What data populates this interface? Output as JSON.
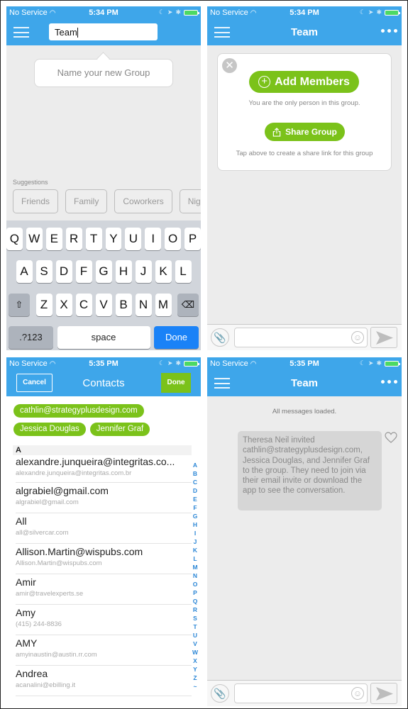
{
  "status_bar": {
    "carrier": "No Service",
    "time_screen1": "5:34 PM",
    "time_screen2": "5:34 PM",
    "time_screen3": "5:35 PM",
    "time_screen4": "5:35 PM"
  },
  "name_group_screen": {
    "title_input_value": "Team",
    "tooltip": "Name your new Group",
    "suggestions_label": "Suggestions",
    "suggestions": [
      "Friends",
      "Family",
      "Coworkers",
      "Nigh"
    ],
    "keyboard": {
      "row1": [
        "Q",
        "W",
        "E",
        "R",
        "T",
        "Y",
        "U",
        "I",
        "O",
        "P"
      ],
      "row2": [
        "A",
        "S",
        "D",
        "F",
        "G",
        "H",
        "J",
        "K",
        "L"
      ],
      "row3": [
        "Z",
        "X",
        "C",
        "V",
        "B",
        "N",
        "M"
      ],
      "symbols_key": ".?123",
      "space_key": "space",
      "done_key": "Done"
    }
  },
  "group_screen": {
    "title": "Team",
    "add_members_label": "Add Members",
    "only_person_note": "You are the only person in this group.",
    "share_group_label": "Share Group",
    "share_note": "Tap above to create a share link for this group"
  },
  "contacts_screen": {
    "title": "Contacts",
    "cancel_label": "Cancel",
    "done_label": "Done",
    "selected_tags": [
      "cathlin@strategyplusdesign.com",
      "Jessica Douglas",
      "Jennifer Graf"
    ],
    "section_header": "A",
    "contacts": [
      {
        "name": "alexandre.junqueira@integritas.co...",
        "detail": "alexandre.junqueira@integritas.com.br"
      },
      {
        "name": "algrabiel@gmail.com",
        "detail": "algrabiel@gmail.com"
      },
      {
        "name": "All",
        "detail": "all@silvercar.com"
      },
      {
        "name": "Allison.Martin@wispubs.com",
        "detail": "Allison.Martin@wispubs.com"
      },
      {
        "name": "Amir",
        "detail": "amir@travelexperts.se"
      },
      {
        "name": "Amy",
        "detail": "(415) 244-8836"
      },
      {
        "name": "AMY",
        "detail": "amyinaustin@austin.rr.com"
      },
      {
        "name": "Andrea",
        "detail": "acanalini@ebilling.it"
      }
    ],
    "index_letters": [
      "A",
      "B",
      "C",
      "D",
      "E",
      "F",
      "G",
      "H",
      "I",
      "J",
      "K",
      "L",
      "M",
      "N",
      "O",
      "P",
      "Q",
      "R",
      "S",
      "T",
      "U",
      "V",
      "W",
      "X",
      "Y",
      "Z",
      "~"
    ]
  },
  "chat_screen": {
    "title": "Team",
    "loaded_note": "All messages loaded.",
    "message": "Theresa Neil invited cathlin@strategyplusdesign.com, Jessica Douglas, and Jennifer Graf to the group. They need to join via their email invite or download the app to see the conversation.",
    "message_input_value": ""
  },
  "colors": {
    "nav_blue": "#3ea6ea",
    "accent_green": "#7bc21a",
    "keyboard_done_blue": "#1a82f7"
  }
}
